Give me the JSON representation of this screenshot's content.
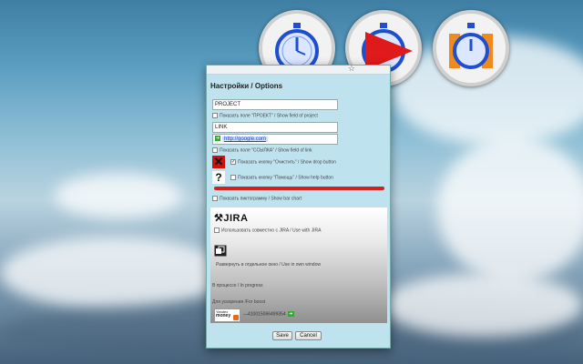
{
  "window": {
    "title": "Настройки / Options",
    "project_input": "PROJECT",
    "show_project_label": "Показать поле \"ПРОЕКТ\" / Show field of project",
    "link_input": "LINK",
    "link_value": "http://google.com",
    "show_link_label": "Показать поле \"ССЫЛКА\" / Show field of link",
    "show_clear_label": "Показать кнопку \"Очистить\" / Show drop button",
    "show_help_label": "Показать кнопку \"Помощь\" / Show help button",
    "help_glyph": "?",
    "clear_glyph": "✕",
    "show_chart_label": "Показать пиктограмму / Show bar chart",
    "progress": {
      "green_fraction": 0.0,
      "red_fraction": 1.0,
      "color_green": "#2a9a3a",
      "color_red": "#d62020"
    },
    "jira_logo": "JIRA",
    "use_jira_label": "Использовать совместно с JIRA / Use with JIRA",
    "own_window_label": "Развернуть в отдельное окно / Use in own window",
    "in_progress_label": "В процессе / In progress",
    "boost_label": "Для ускорения /For boost",
    "ym_text_1": "Yandex",
    "ym_text_2": "money",
    "wallet": "—410015066499354",
    "save_label": "Save",
    "cancel_label": "Cancel"
  },
  "badges": [
    {
      "icon": "stopwatch-icon"
    },
    {
      "icon": "play-stopwatch-icon",
      "accent": "#e01a1a"
    },
    {
      "icon": "pause-stopwatch-icon",
      "accent": "#f08a1e"
    }
  ],
  "colors": {
    "accent_blue": "#1f4fcf",
    "window_bg": "#bfe3ee"
  }
}
